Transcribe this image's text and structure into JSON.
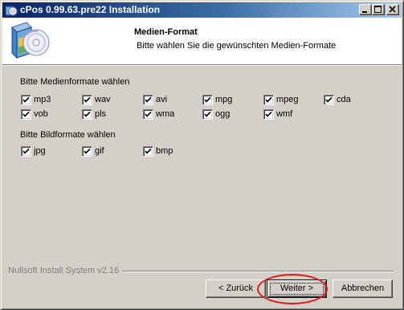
{
  "window": {
    "title": "cPos 0.99.63.pre22 Installation",
    "icons": {
      "app": "installer-icon",
      "minimize": "minimize-icon",
      "maximize": "maximize-icon",
      "close": "close-icon"
    }
  },
  "header": {
    "title": "Medien-Format",
    "subtitle": "Bitte wählen Sie die gewünschten Medien-Formate",
    "logo_icon": "cd-box-icon"
  },
  "media_group": {
    "label": "Bitte Medienformate wählen",
    "options": [
      {
        "label": "mp3",
        "checked": true
      },
      {
        "label": "wav",
        "checked": true
      },
      {
        "label": "avi",
        "checked": true
      },
      {
        "label": "mpg",
        "checked": true
      },
      {
        "label": "mpeg",
        "checked": true
      },
      {
        "label": "cda",
        "checked": true
      },
      {
        "label": "vob",
        "checked": true
      },
      {
        "label": "pls",
        "checked": true
      },
      {
        "label": "wma",
        "checked": true
      },
      {
        "label": "ogg",
        "checked": true
      },
      {
        "label": "wmf",
        "checked": true
      }
    ]
  },
  "image_group": {
    "label": "Bitte Bildformate wählen",
    "options": [
      {
        "label": "jpg",
        "checked": true
      },
      {
        "label": "gif",
        "checked": true
      },
      {
        "label": "bmp",
        "checked": true
      }
    ]
  },
  "footer": {
    "branding": "Nullsoft Install System v2.16",
    "back_label": "< Zurück",
    "next_label": "Weiter >",
    "cancel_label": "Abbrechen"
  },
  "colors": {
    "title_gradient_start": "#0a246a",
    "title_gradient_end": "#a6caf0",
    "dialog_face": "#d4d0c8",
    "highlight_annotation": "#e01818"
  }
}
